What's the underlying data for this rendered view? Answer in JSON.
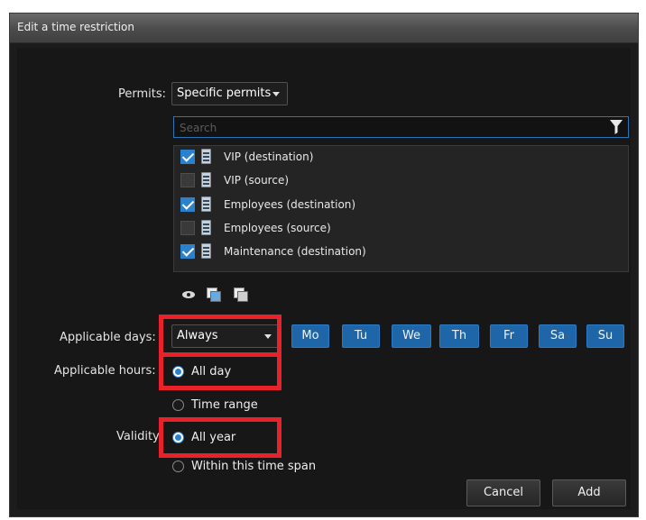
{
  "dialog": {
    "title": "Edit a time restriction"
  },
  "permits": {
    "label": "Permits:",
    "selected": "Specific permits",
    "search_placeholder": "Search",
    "items": [
      {
        "label": "VIP (destination)",
        "checked": true
      },
      {
        "label": "VIP (source)",
        "checked": false
      },
      {
        "label": "Employees (destination)",
        "checked": true
      },
      {
        "label": "Employees (source)",
        "checked": false
      },
      {
        "label": "Maintenance (destination)",
        "checked": true
      }
    ]
  },
  "applicable_days": {
    "label": "Applicable days:",
    "selected": "Always",
    "days": [
      "Mo",
      "Tu",
      "We",
      "Th",
      "Fr",
      "Sa",
      "Su"
    ]
  },
  "applicable_hours": {
    "label": "Applicable hours:",
    "options": [
      "All day",
      "Time range"
    ],
    "selected": "All day"
  },
  "validity": {
    "label": "Validity:",
    "options": [
      "All year",
      "Within this time span"
    ],
    "selected": "All year"
  },
  "buttons": {
    "cancel": "Cancel",
    "add": "Add"
  },
  "colors": {
    "accent": "#2a82cf",
    "highlight": "#e8212b",
    "day_button": "#1e66a8"
  }
}
